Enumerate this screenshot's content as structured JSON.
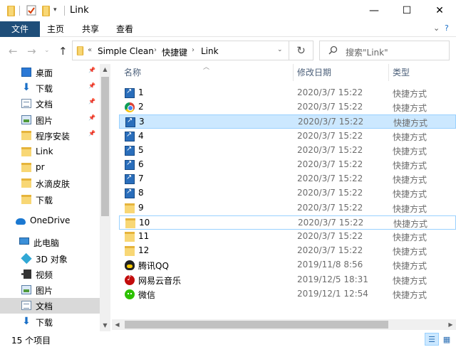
{
  "window": {
    "title": "Link",
    "minimize_glyph": "—",
    "maximize_glyph": "☐",
    "close_glyph": "✕"
  },
  "ribbon": {
    "tabs": [
      "文件",
      "主页",
      "共享",
      "查看"
    ]
  },
  "address": {
    "overflow": "«",
    "crumbs": [
      "Simple Clean",
      "快捷键",
      "Link"
    ],
    "search_placeholder": "搜索\"Link\""
  },
  "nav_pane": {
    "items": [
      {
        "label": "桌面",
        "icon": "desktop-icon",
        "pinned": true
      },
      {
        "label": "下载",
        "icon": "download-icon",
        "pinned": true
      },
      {
        "label": "文档",
        "icon": "document-icon",
        "pinned": true
      },
      {
        "label": "图片",
        "icon": "pictures-icon",
        "pinned": true
      },
      {
        "label": "程序安装",
        "icon": "folder-icon",
        "pinned": true
      },
      {
        "label": "Link",
        "icon": "folder-icon",
        "pinned": false
      },
      {
        "label": "pr",
        "icon": "folder-icon",
        "pinned": false
      },
      {
        "label": "水滴皮肤",
        "icon": "folder-icon",
        "pinned": false
      },
      {
        "label": "下载",
        "icon": "folder-icon",
        "pinned": false
      },
      {
        "label": "OneDrive",
        "icon": "onedrive-icon",
        "pinned": false
      },
      {
        "label": "此电脑",
        "icon": "computer-icon",
        "pinned": false
      },
      {
        "label": "3D 对象",
        "icon": "3d-objects-icon",
        "pinned": false
      },
      {
        "label": "视频",
        "icon": "video-icon",
        "pinned": false
      },
      {
        "label": "图片",
        "icon": "pictures-icon",
        "pinned": false
      },
      {
        "label": "文档",
        "icon": "document-icon",
        "pinned": false
      },
      {
        "label": "下载",
        "icon": "download-icon",
        "pinned": false
      }
    ]
  },
  "file_list": {
    "columns": [
      "名称",
      "修改日期",
      "类型"
    ],
    "rows": [
      {
        "name": "1",
        "date": "2020/3/7 15:22",
        "type": "快捷方式",
        "icon": "shortcut-icon"
      },
      {
        "name": "2",
        "date": "2020/3/7 15:22",
        "type": "快捷方式",
        "icon": "chrome-icon"
      },
      {
        "name": "3",
        "date": "2020/3/7 15:22",
        "type": "快捷方式",
        "icon": "shortcut-icon"
      },
      {
        "name": "4",
        "date": "2020/3/7 15:22",
        "type": "快捷方式",
        "icon": "shortcut-icon"
      },
      {
        "name": "5",
        "date": "2020/3/7 15:22",
        "type": "快捷方式",
        "icon": "shortcut-icon"
      },
      {
        "name": "6",
        "date": "2020/3/7 15:22",
        "type": "快捷方式",
        "icon": "shortcut-icon"
      },
      {
        "name": "7",
        "date": "2020/3/7 15:22",
        "type": "快捷方式",
        "icon": "shortcut-icon"
      },
      {
        "name": "8",
        "date": "2020/3/7 15:22",
        "type": "快捷方式",
        "icon": "shortcut-icon"
      },
      {
        "name": "9",
        "date": "2020/3/7 15:22",
        "type": "快捷方式",
        "icon": "folder-shortcut-icon"
      },
      {
        "name": "10",
        "date": "2020/3/7 15:22",
        "type": "快捷方式",
        "icon": "folder-shortcut-icon"
      },
      {
        "name": "11",
        "date": "2020/3/7 15:22",
        "type": "快捷方式",
        "icon": "folder-shortcut-icon"
      },
      {
        "name": "12",
        "date": "2020/3/7 15:22",
        "type": "快捷方式",
        "icon": "folder-shortcut-icon"
      },
      {
        "name": "腾讯QQ",
        "date": "2019/11/8 8:56",
        "type": "快捷方式",
        "icon": "qq-icon"
      },
      {
        "name": "网易云音乐",
        "date": "2019/12/5 18:31",
        "type": "快捷方式",
        "icon": "netease-music-icon"
      },
      {
        "name": "微信",
        "date": "2019/12/1 12:54",
        "type": "快捷方式",
        "icon": "wechat-icon"
      }
    ]
  },
  "status": {
    "item_count": "15 个项目"
  },
  "colors": {
    "file_tab_bg": "#1f4e79",
    "selection_bg": "#cce8ff",
    "selection_border": "#99d1ff",
    "column_header_text": "#4c607a"
  }
}
